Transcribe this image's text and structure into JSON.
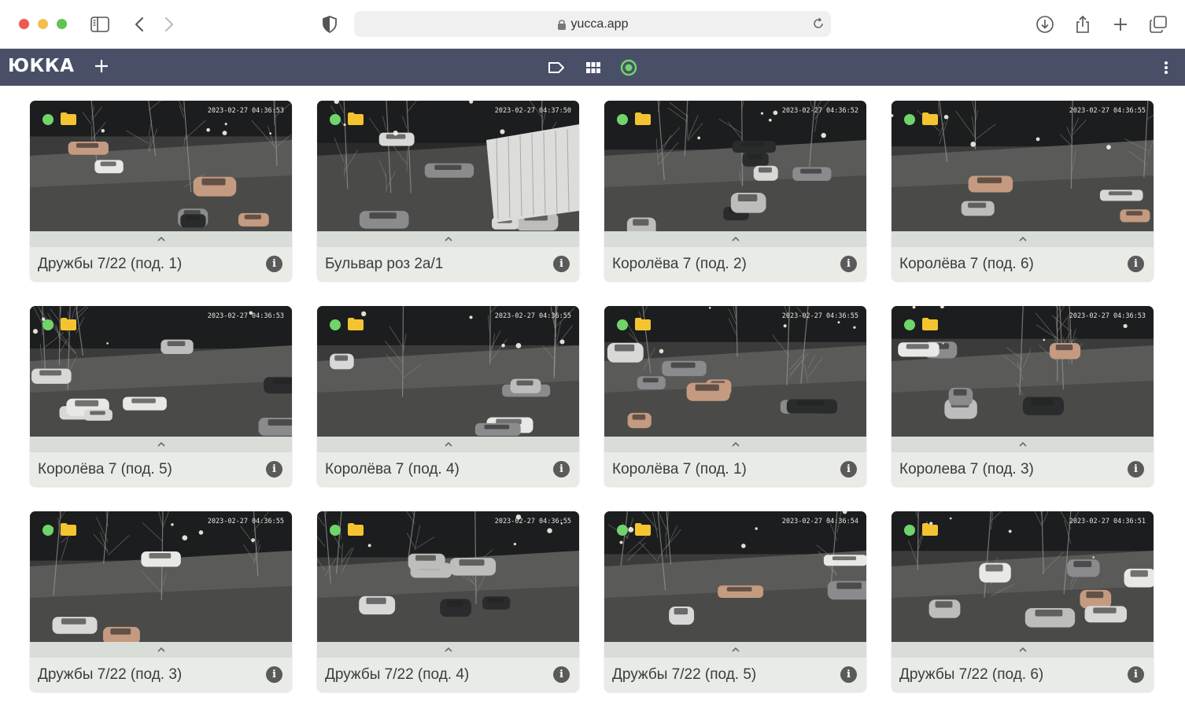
{
  "browser": {
    "url": "yucca.app"
  },
  "header": {
    "logo": "ЮККА"
  },
  "cameras": [
    {
      "name": "Дружбы 7/22 (под. 1)",
      "timestamp": "2023-02-27 04:36:53",
      "scene": "0"
    },
    {
      "name": "Бульвар роз 2а/1",
      "timestamp": "2023-02-27 04:37:50",
      "scene": "1"
    },
    {
      "name": "Королёва 7 (под. 2)",
      "timestamp": "2023-02-27 04:36:52",
      "scene": "2"
    },
    {
      "name": "Королёва 7 (под. 6)",
      "timestamp": "2023-02-27 04:36:55",
      "scene": "3"
    },
    {
      "name": "Королёва 7 (под. 5)",
      "timestamp": "2023-02-27 04:36:53",
      "scene": "4"
    },
    {
      "name": "Королёва 7 (под. 4)",
      "timestamp": "2023-02-27 04:36:55",
      "scene": "5"
    },
    {
      "name": "Королёва 7 (под. 1)",
      "timestamp": "2023-02-27 04:36:55",
      "scene": "6"
    },
    {
      "name": "Королева 7 (под. 3)",
      "timestamp": "2023-02-27 04:36:53",
      "scene": "7"
    },
    {
      "name": "Дружбы 7/22 (под. 3)",
      "timestamp": "2023-02-27 04:36:55",
      "scene": "8"
    },
    {
      "name": "Дружбы 7/22 (под. 4)",
      "timestamp": "2023-02-27 04:36:55",
      "scene": "9"
    },
    {
      "name": "Дружбы 7/22 (под. 5)",
      "timestamp": "2023-02-27 04:36:54",
      "scene": "10"
    },
    {
      "name": "Дружбы 7/22 (под. 6)",
      "timestamp": "2023-02-27 04:36:51",
      "scene": "11"
    }
  ],
  "colors": {
    "header_bg": "#4a4f68",
    "status_online": "#6fd56b",
    "folder": "#f4c430"
  }
}
